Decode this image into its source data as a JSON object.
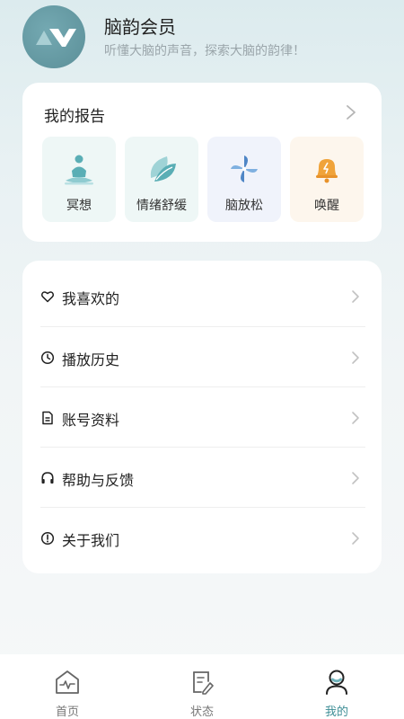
{
  "header": {
    "app_name": "脑韵会员",
    "slogan": "听懂大脑的声音，探索大脑的韵律！"
  },
  "report": {
    "title": "我的报告",
    "tiles": [
      {
        "label": "冥想",
        "icon": "meditation-icon",
        "bg": "#eef7f6"
      },
      {
        "label": "情绪舒缓",
        "icon": "leaf-icon",
        "bg": "#eef7f6"
      },
      {
        "label": "脑放松",
        "icon": "pinwheel-icon",
        "bg": "#f0f3fb"
      },
      {
        "label": "唤醒",
        "icon": "alarm-bell-icon",
        "bg": "#fdf6ed"
      }
    ]
  },
  "menu": [
    {
      "label": "我喜欢的",
      "icon": "heart-icon"
    },
    {
      "label": "播放历史",
      "icon": "clock-icon"
    },
    {
      "label": "账号资料",
      "icon": "document-icon"
    },
    {
      "label": "帮助与反馈",
      "icon": "headset-icon"
    },
    {
      "label": "关于我们",
      "icon": "info-icon"
    }
  ],
  "tabbar": [
    {
      "label": "首页",
      "icon": "home-icon",
      "active": false
    },
    {
      "label": "状态",
      "icon": "status-notebook-icon",
      "active": false
    },
    {
      "label": "我的",
      "icon": "profile-icon",
      "active": true
    }
  ],
  "colors": {
    "accent": "#3e8e96",
    "tile_teal": "#5aaeb5",
    "tile_blue": "#4f86c6",
    "tile_orange": "#f0a33a"
  }
}
